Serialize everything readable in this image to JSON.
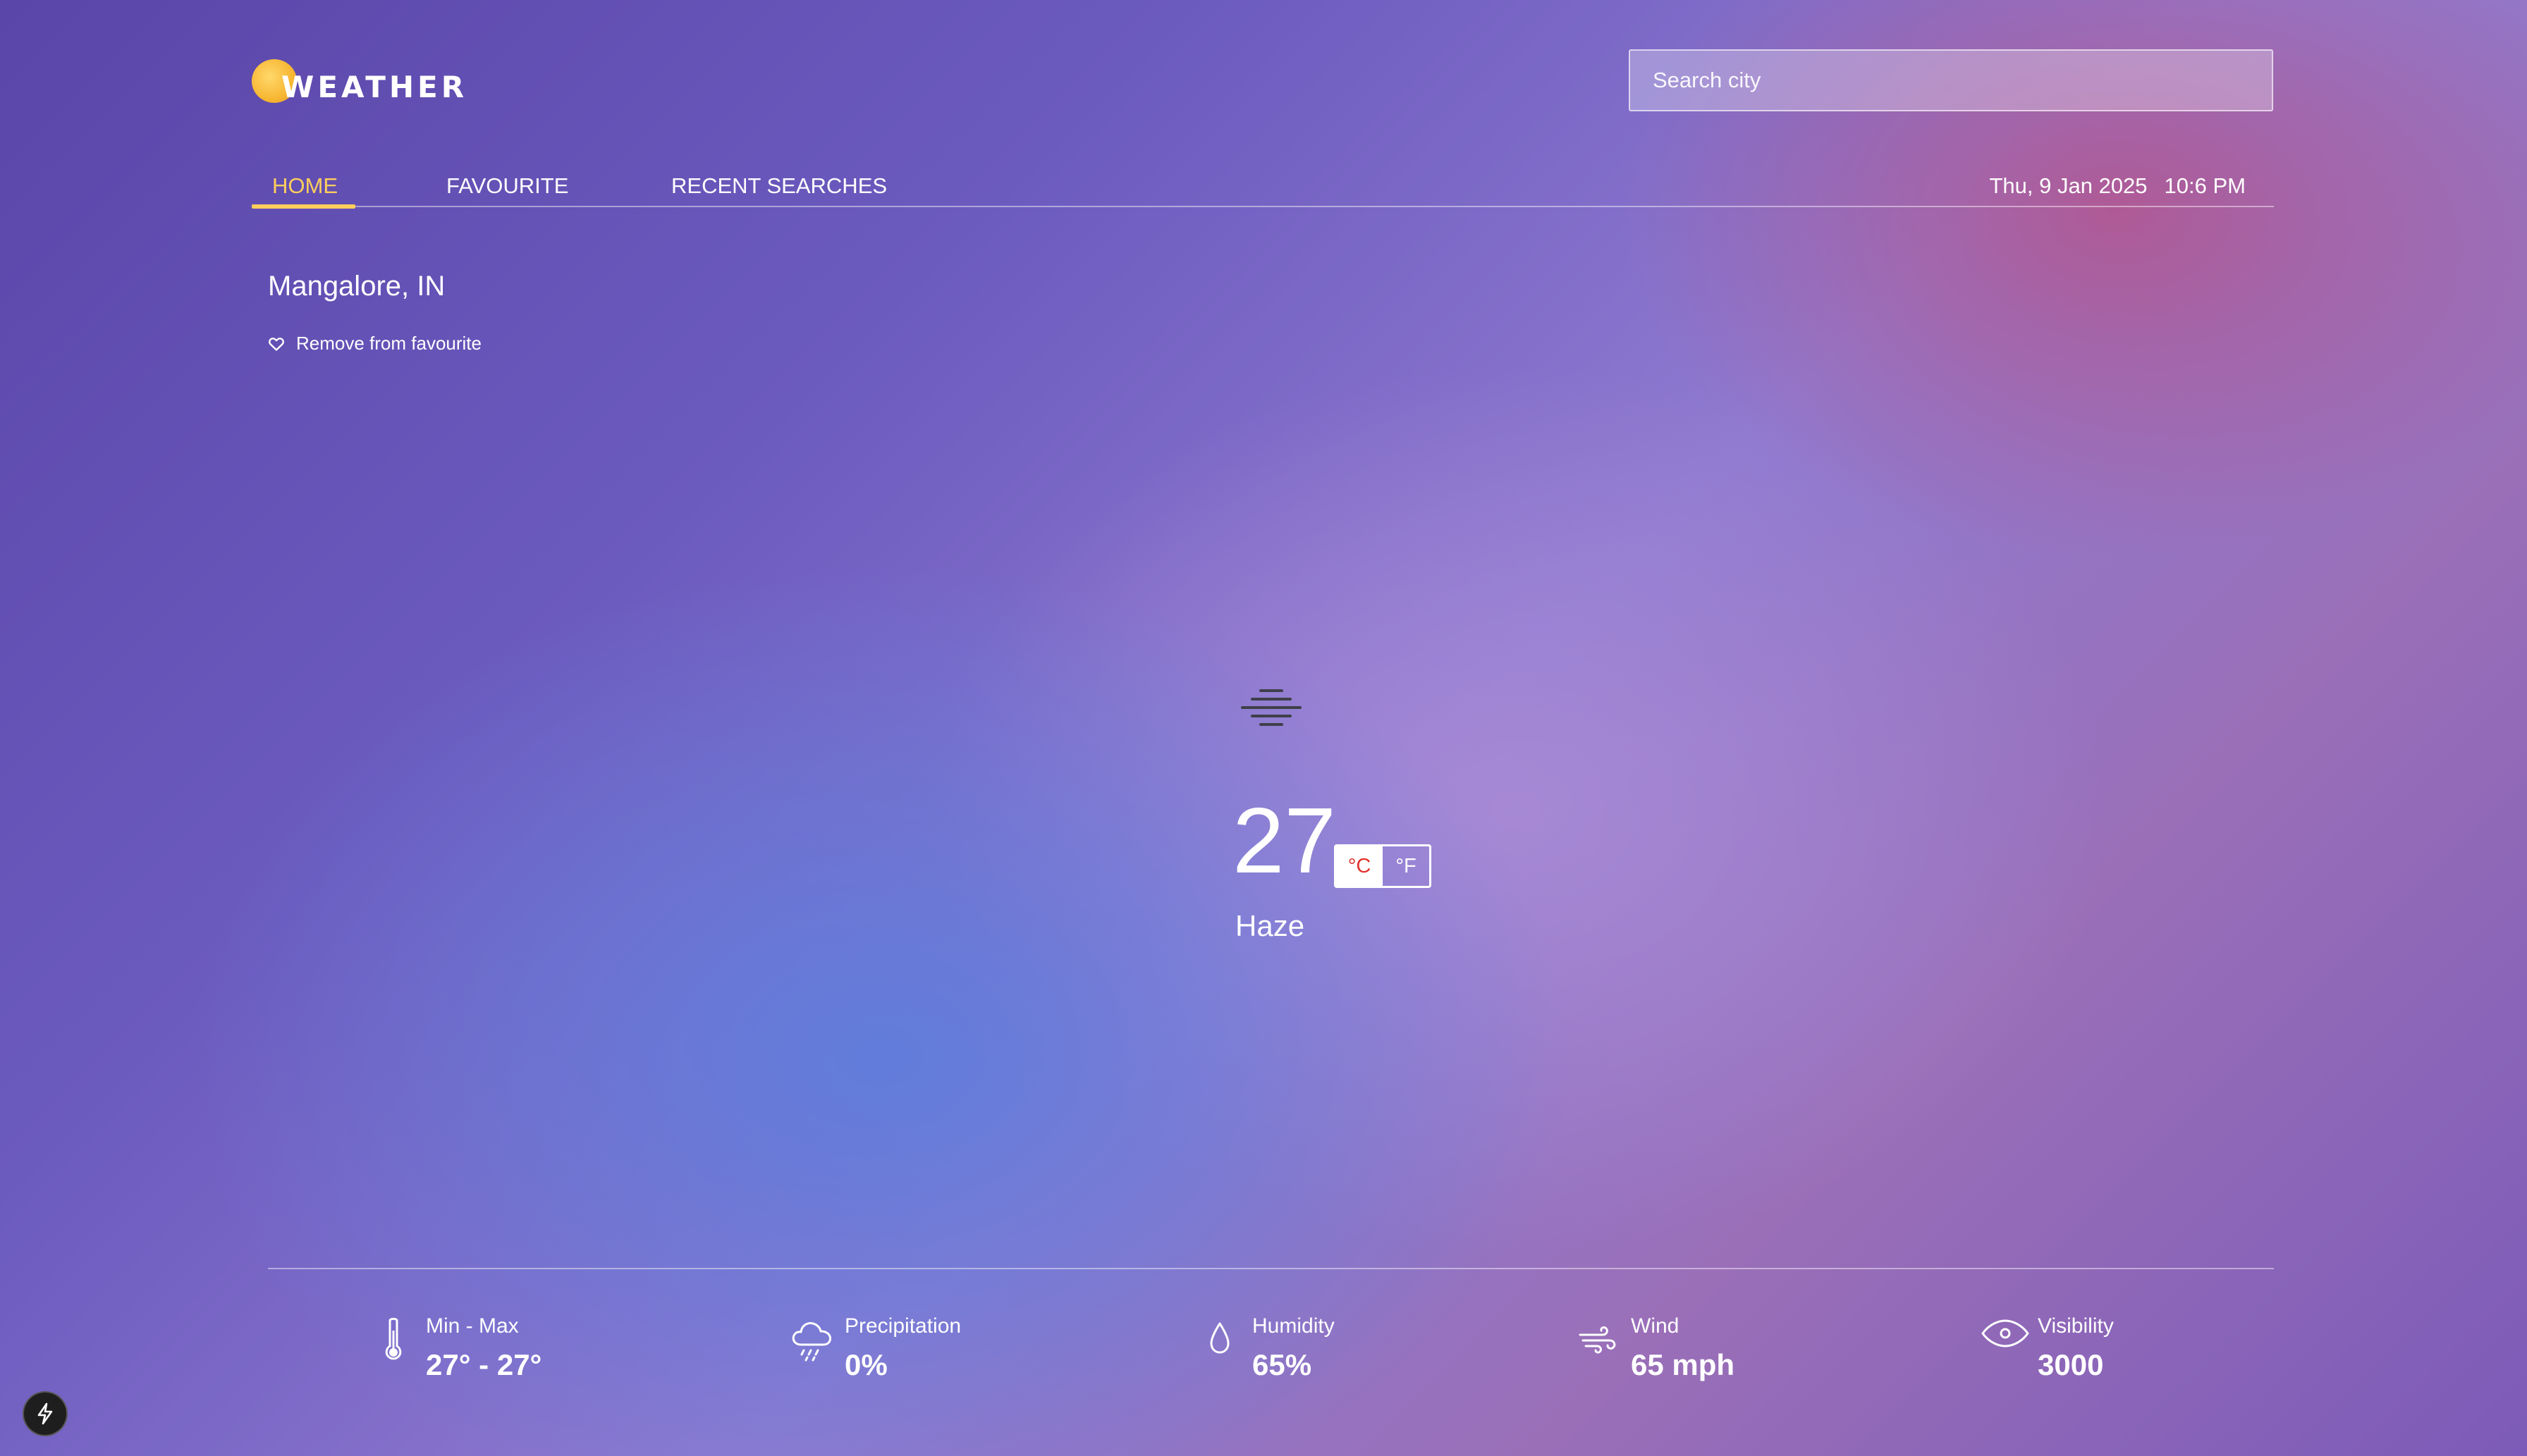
{
  "header": {
    "logo_text": "WEATHER",
    "search_placeholder": "Search city",
    "search_value": ""
  },
  "nav": {
    "tabs": [
      {
        "label": "HOME",
        "active": true
      },
      {
        "label": "FAVOURITE",
        "active": false
      },
      {
        "label": "RECENT SEARCHES",
        "active": false
      }
    ],
    "date": "Thu, 9 Jan 2025",
    "time": "10:6 PM"
  },
  "location": {
    "name": "Mangalore, IN",
    "favourite_label": "Remove from favourite"
  },
  "current": {
    "temperature": "27",
    "condition": "Haze",
    "condition_icon": "haze-icon",
    "unit_options": [
      {
        "label": "°C",
        "active": true
      },
      {
        "label": "°F",
        "active": false
      }
    ]
  },
  "stats": [
    {
      "label": "Min - Max",
      "value": "27° - 27°",
      "icon": "thermometer-icon"
    },
    {
      "label": "Precipitation",
      "value": "0%",
      "icon": "rain-cloud-icon"
    },
    {
      "label": "Humidity",
      "value": "65%",
      "icon": "droplet-icon"
    },
    {
      "label": "Wind",
      "value": "65 mph",
      "icon": "wind-icon"
    },
    {
      "label": "Visibility",
      "value": "3000",
      "icon": "eye-icon"
    }
  ],
  "colors": {
    "accent": "#ffce5c",
    "unit_active_text": "#e0332e",
    "badge_bg": "#1e1e1e"
  },
  "dev_badge_icon": "lightning-icon"
}
